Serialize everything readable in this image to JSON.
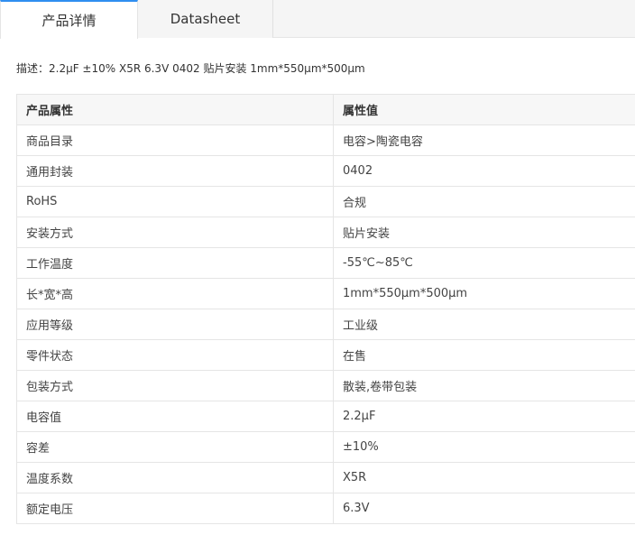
{
  "tabs": [
    {
      "label": "产品详情",
      "active": true
    },
    {
      "label": "Datasheet",
      "active": false
    }
  ],
  "description": "描述：2.2μF ±10% X5R 6.3V 0402 贴片安装 1mm*550μm*500μm",
  "table": {
    "headers": [
      "产品属性",
      "属性值"
    ],
    "rows": [
      [
        "商品目录",
        "电容>陶瓷电容"
      ],
      [
        "通用封装",
        "0402"
      ],
      [
        "RoHS",
        "合规"
      ],
      [
        "安装方式",
        "贴片安装"
      ],
      [
        "工作温度",
        "-55℃~85℃"
      ],
      [
        "长*宽*高",
        "1mm*550μm*500μm"
      ],
      [
        "应用等级",
        "工业级"
      ],
      [
        "零件状态",
        "在售"
      ],
      [
        "包装方式",
        "散装,卷带包装"
      ],
      [
        "电容值",
        "2.2μF"
      ],
      [
        "容差",
        "±10%"
      ],
      [
        "温度系数",
        "X5R"
      ],
      [
        "额定电压",
        "6.3V"
      ]
    ]
  },
  "colors": {
    "active_tab_border": "#2f8ef0",
    "tabbar_bg": "#f5f5f5",
    "header_bg": "#f7f7f7",
    "border": "#e5e5e5"
  }
}
